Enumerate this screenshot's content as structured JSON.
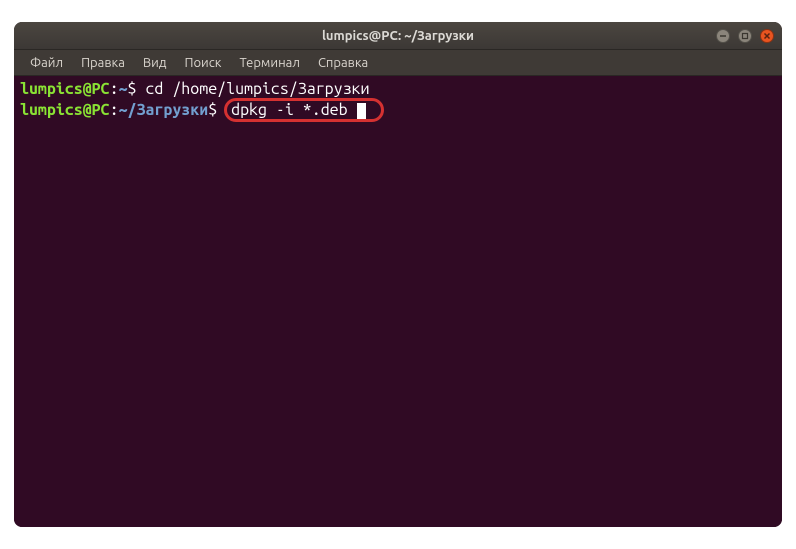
{
  "window": {
    "title": "lumpics@PC: ~/Загрузки"
  },
  "menu": {
    "file": "Файл",
    "edit": "Правка",
    "view": "Вид",
    "search": "Поиск",
    "terminal": "Терминал",
    "help": "Справка"
  },
  "terminal": {
    "lines": [
      {
        "user": "lumpics@PC",
        "colon": ":",
        "path": "~",
        "dollar": "$ ",
        "command": "cd /home/lumpics/Загрузки"
      },
      {
        "user": "lumpics@PC",
        "colon": ":",
        "path": "~/Загрузки",
        "dollar": "$ ",
        "command": "dpkg -i *.deb"
      }
    ]
  },
  "colors": {
    "terminal_bg": "#300a24",
    "prompt_user": "#8ae234",
    "prompt_path": "#729fcf",
    "highlight_border": "#d53131",
    "close_btn": "#e95420"
  }
}
